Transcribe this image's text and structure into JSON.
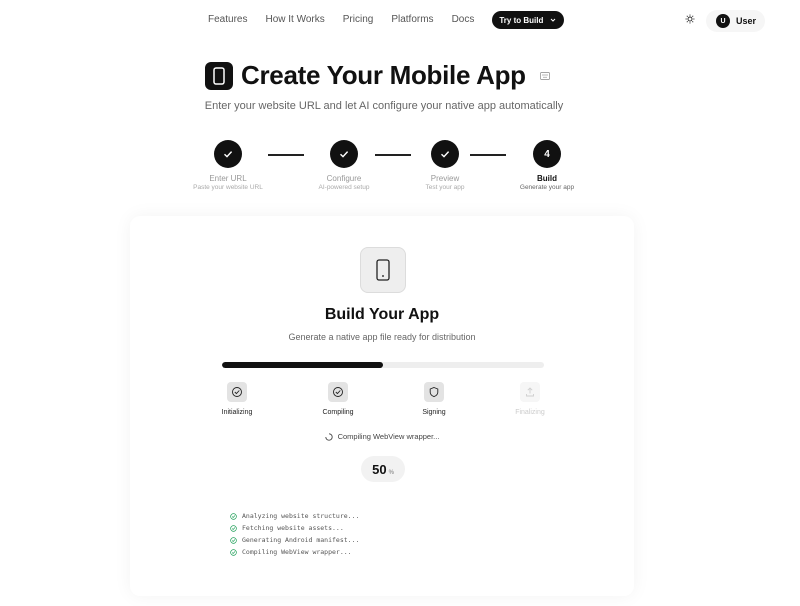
{
  "nav": {
    "links": [
      "Features",
      "How It Works",
      "Pricing",
      "Platforms",
      "Docs"
    ],
    "cta_label": "Try to Build",
    "user_initial": "U",
    "user_label": "User",
    "theme_icon": "sun-icon"
  },
  "hero": {
    "title": "Create Your Mobile App",
    "subtitle": "Enter your website URL and let AI configure your native app automatically"
  },
  "steps": [
    {
      "title": "Enter URL",
      "desc": "Paste your website URL",
      "status": "done"
    },
    {
      "title": "Configure",
      "desc": "AI-powered setup",
      "status": "done"
    },
    {
      "title": "Preview",
      "desc": "Test your app",
      "status": "done"
    },
    {
      "title": "Build",
      "desc": "Generate your app",
      "status": "active",
      "number": "4"
    }
  ],
  "build": {
    "title": "Build Your App",
    "subtitle": "Generate a native app file ready for distribution",
    "progress_percent": 50,
    "percent_label": "50",
    "percent_sign": "%",
    "status_text": "Compiling WebView wrapper...",
    "stages": [
      {
        "label": "Initializing",
        "icon": "check-circle-icon",
        "status": "done"
      },
      {
        "label": "Compiling",
        "icon": "check-circle-icon",
        "status": "done"
      },
      {
        "label": "Signing",
        "icon": "shield-icon",
        "status": "done"
      },
      {
        "label": "Finalizing",
        "icon": "upload-icon",
        "status": "pending"
      }
    ],
    "log": [
      "Analyzing website structure...",
      "Fetching website assets...",
      "Generating Android manifest...",
      "Compiling WebView wrapper..."
    ]
  },
  "colors": {
    "primary": "#111111",
    "success": "#22a05a",
    "muted": "#999999"
  }
}
